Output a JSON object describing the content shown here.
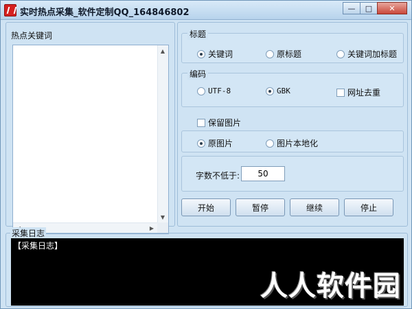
{
  "window": {
    "title": "实时热点采集_软件定制QQ_164846802",
    "controls": {
      "minimize": "—",
      "maximize": "□",
      "close": "✕"
    }
  },
  "keywords": {
    "label": "热点关键词",
    "value": "",
    "scroll_up": "▲",
    "scroll_down": "▼",
    "scroll_left": "◀",
    "scroll_right": "▶"
  },
  "title_group": {
    "label": "标题",
    "options": [
      "关键词",
      "原标题",
      "关键词加标题"
    ],
    "selected": "关键词"
  },
  "encoding_group": {
    "label": "编码",
    "options": [
      "UTF-8",
      "GBK"
    ],
    "selected": "GBK",
    "dedupe_label": "网址去重",
    "dedupe_checked": false
  },
  "image_group": {
    "keep_label": "保留图片",
    "keep_checked": false,
    "options": [
      "原图片",
      "图片本地化"
    ],
    "selected": "原图片"
  },
  "word_count": {
    "label": "字数不低于:",
    "value": "50"
  },
  "buttons": {
    "start": "开始",
    "pause": "暂停",
    "resume": "继续",
    "stop": "停止"
  },
  "log": {
    "label": "采集日志",
    "line": "【采集日志】",
    "watermark": "人人软件园"
  }
}
